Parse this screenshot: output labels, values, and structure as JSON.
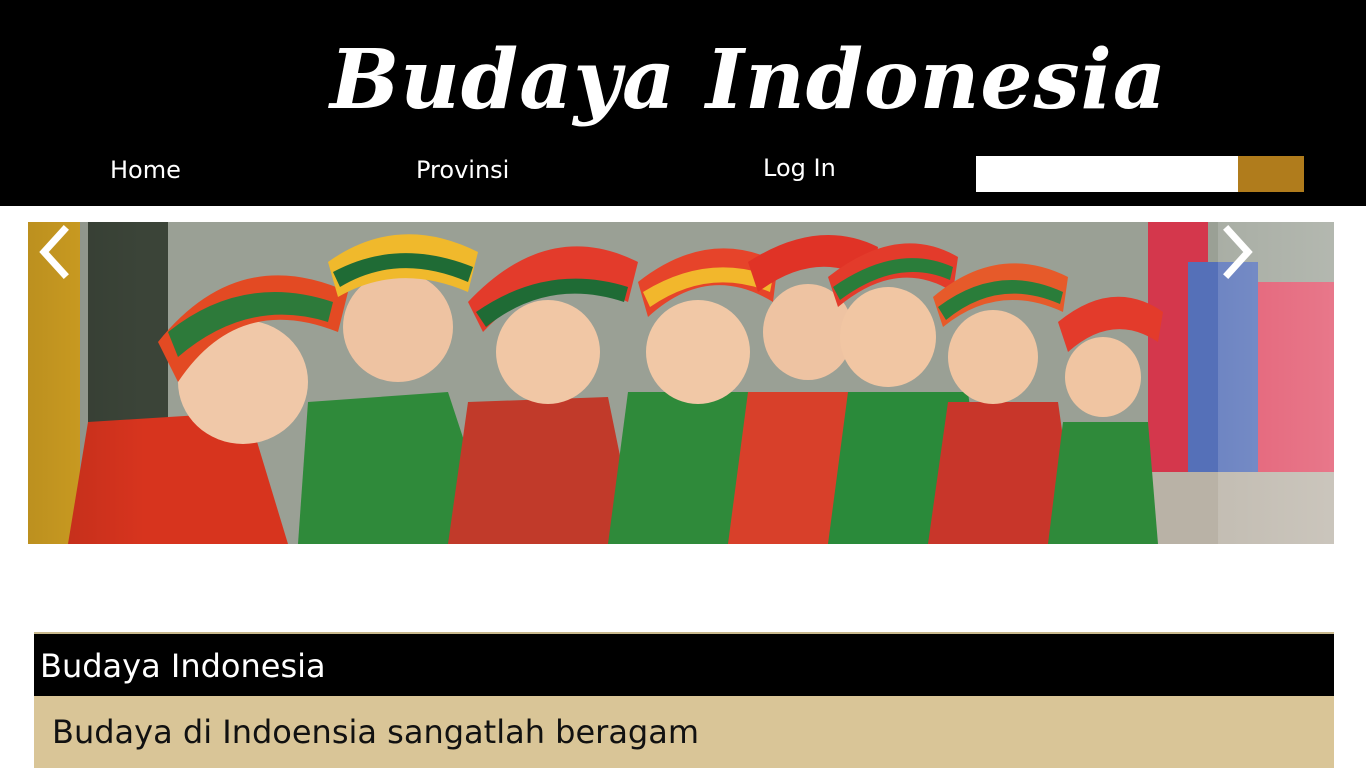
{
  "brand": {
    "title": "Budaya Indonesia"
  },
  "nav": {
    "home": "Home",
    "provinsi": "Provinsi",
    "login": "Log In"
  },
  "search": {
    "placeholder": "",
    "button_label": ""
  },
  "carousel": {
    "prev_icon": "chevron-left-icon",
    "next_icon": "chevron-right-icon",
    "image": "group of girls in traditional costumes"
  },
  "section": {
    "title": "Budaya Indonesia",
    "body": "Budaya di Indoensia sangatlah beragam"
  },
  "colors": {
    "header_bg": "#000000",
    "search_button": "#b07c1c",
    "section_body_bg": "#d9c597"
  }
}
